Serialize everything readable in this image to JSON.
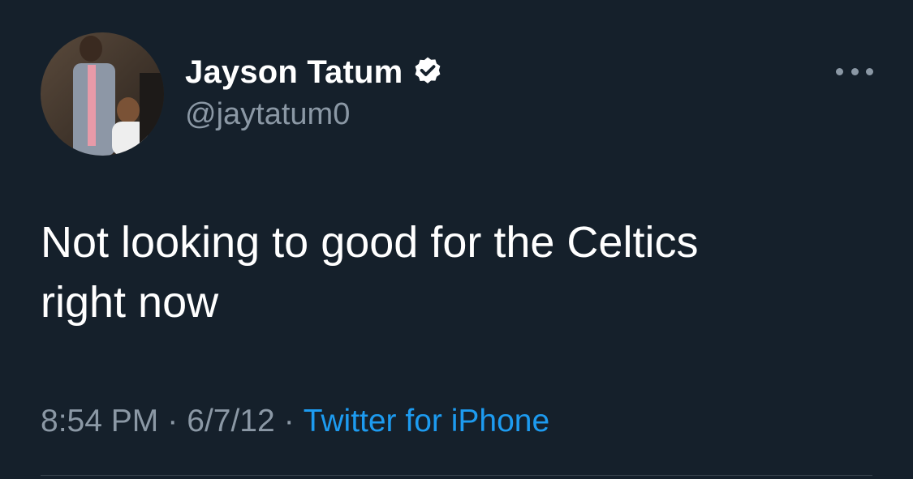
{
  "author": {
    "display_name": "Jayson Tatum",
    "handle": "@jaytatum0",
    "verified": true
  },
  "tweet": {
    "text": "Not looking to good for the Celtics\nright now"
  },
  "meta": {
    "time": "8:54 PM",
    "date": "6/7/12",
    "separator": "·",
    "source": "Twitter for iPhone"
  },
  "icons": {
    "verified": "verified-badge-icon",
    "more": "more-options-icon"
  },
  "colors": {
    "background": "#15202b",
    "text": "#ffffff",
    "secondary_text": "#8b98a5",
    "link": "#1d9bf0"
  }
}
